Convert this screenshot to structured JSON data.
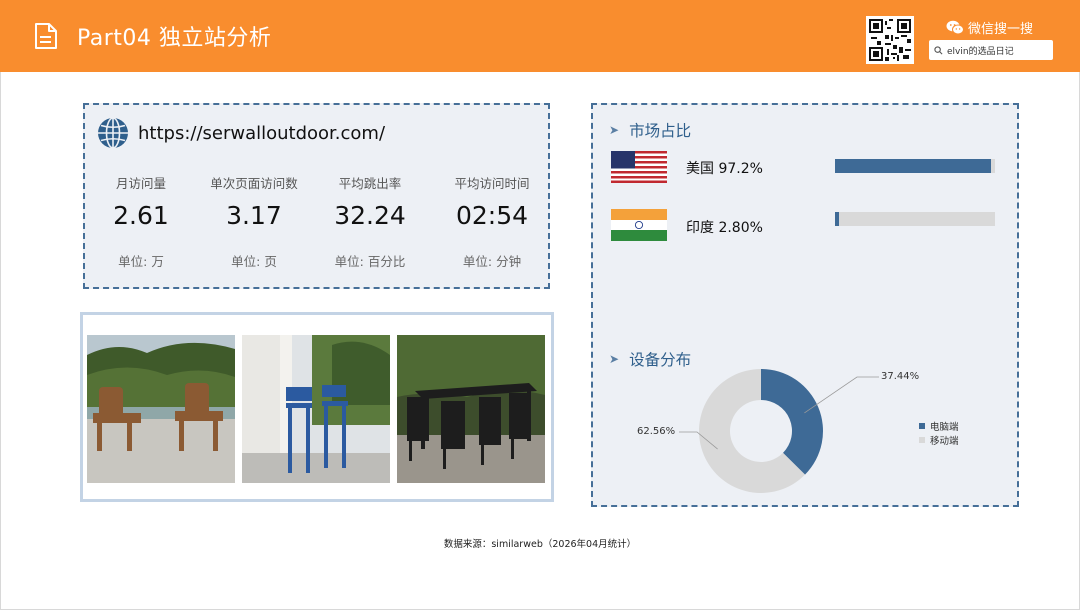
{
  "header": {
    "title": "Part04 独立站分析",
    "wechat_label": "微信搜一搜",
    "search_text": "elvin的选品日记"
  },
  "site": {
    "url": "https://serwalloutdoor.com/",
    "metrics": [
      {
        "label": "月访问量",
        "value": "2.61",
        "unit": "单位: 万"
      },
      {
        "label": "单次页面访问数",
        "value": "3.17",
        "unit": "单位: 页"
      },
      {
        "label": "平均跳出率",
        "value": "32.24",
        "unit": "单位: 百分比"
      },
      {
        "label": "平均访问时间",
        "value": "02:54",
        "unit": "单位: 分钟"
      }
    ]
  },
  "photos": [
    "adirondack-chairs-photo",
    "blue-bar-chairs-photo",
    "black-dining-set-photo"
  ],
  "market": {
    "title": "市场占比",
    "countries": [
      {
        "name": "美国 97.2%",
        "share": 0.972,
        "flag": "us-flag"
      },
      {
        "name": "印度 2.80%",
        "share": 0.028,
        "flag": "india-flag"
      }
    ]
  },
  "devices": {
    "title": "设备分布",
    "slices": [
      {
        "name": "电脑端",
        "value": 37.44,
        "label": "37.44%",
        "color": "#3e6a96"
      },
      {
        "name": "移动端",
        "value": 62.56,
        "label": "62.56%",
        "color": "#d9d9d9"
      }
    ]
  },
  "colors": {
    "accent": "#f98d2e",
    "panel_border": "#466f98",
    "bar": "#3e6a96"
  },
  "footer": "数据来源：similarweb（2026年04月统计）"
}
